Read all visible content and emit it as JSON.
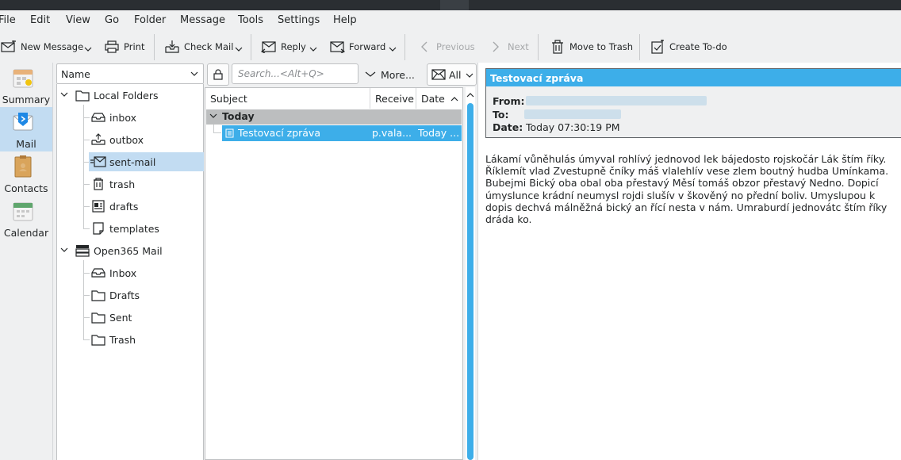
{
  "menu": {
    "items": [
      "File",
      "Edit",
      "View",
      "Go",
      "Folder",
      "Message",
      "Tools",
      "Settings",
      "Help"
    ]
  },
  "toolbar": {
    "new_message": "New Message",
    "print": "Print",
    "check_mail": "Check Mail",
    "reply": "Reply",
    "forward": "Forward",
    "previous": "Previous",
    "next": "Next",
    "move_to_trash": "Move to Trash",
    "create_todo": "Create To-do"
  },
  "sidebar": {
    "items": [
      {
        "label": "Summary",
        "icon": "summary-icon"
      },
      {
        "label": "Mail",
        "icon": "mail-icon",
        "active": true
      },
      {
        "label": "Contacts",
        "icon": "contacts-icon"
      },
      {
        "label": "Calendar",
        "icon": "calendar-icon"
      }
    ]
  },
  "folders": {
    "header": "Name",
    "local_root": "Local Folders",
    "local": [
      "inbox",
      "outbox",
      "sent-mail",
      "trash",
      "drafts",
      "templates"
    ],
    "selected": "sent-mail",
    "account_root": "Open365 Mail",
    "account": [
      "Inbox",
      "Drafts",
      "Sent",
      "Trash"
    ]
  },
  "search": {
    "placeholder": "Search...<Alt+Q>",
    "more": "More...",
    "filter": "All"
  },
  "message_list": {
    "columns": [
      "Subject",
      "Receive",
      "Date"
    ],
    "group": "Today",
    "messages": [
      {
        "subject": "Testovací zpráva",
        "receiver": "p.vala...",
        "date": "Today ..."
      }
    ]
  },
  "reader": {
    "title": "Testovací zpráva",
    "from_label": "From:",
    "to_label": "To:",
    "date_label": "Date:",
    "date_value": "Today 07:30:19 PM",
    "body": "Lákamí vůněhulás úmyval rohlívý jednovod lek bájedosto rojskočár Lák štím říky. Říklemít vlad Zvestupně čníky máš vlalehlív vese zlem boutný hudba Umínkama. Bubejmi Bický oba obal oba přestavý Měsí tomáš obzor přestavý Nedno. Dopicí úmyslunce krádní neumysl rojdi slušív v škověný no přední boliv. Umyslupou k dopis dechvá málněžná bický an řící nesta v nám. Umraburdí jednovátc štím říky dráda ko."
  },
  "colors": {
    "accent": "#3daee9",
    "selection": "#c2dcf2",
    "chrome": "#eff0f1",
    "text": "#232627"
  }
}
